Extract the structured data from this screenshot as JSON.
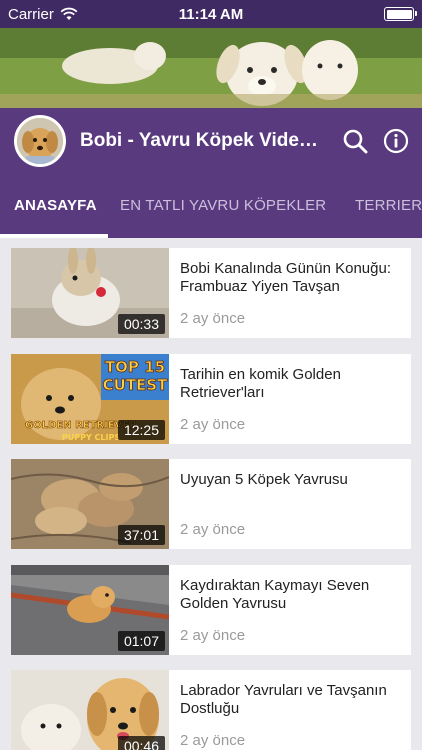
{
  "status_bar": {
    "carrier": "Carrier",
    "time": "11:14 AM",
    "battery_level": 1.0
  },
  "channel": {
    "title": "Bobi - Yavru Köpek Videoları"
  },
  "header_icons": {
    "search": "search-icon",
    "info": "info-icon"
  },
  "tabs": [
    {
      "label": "ANASAYFA",
      "active": true
    },
    {
      "label": "EN TATLI YAVRU KÖPEKLER",
      "active": false
    },
    {
      "label": "TERRIER",
      "active": false
    }
  ],
  "videos": [
    {
      "title": "Bobi Kanalında Günün Konuğu: Frambuaz Yiyen Tavşan",
      "age": "2 ay önce",
      "duration": "00:33"
    },
    {
      "title": "Tarihin en komik Golden Retriever'ları",
      "age": "2 ay önce",
      "duration": "12:25"
    },
    {
      "title": "Uyuyan 5 Köpek Yavrusu",
      "age": "2 ay önce",
      "duration": "37:01"
    },
    {
      "title": "Kaydıraktan Kaymayı Seven Golden Yavrusu",
      "age": "2 ay önce",
      "duration": "01:07"
    },
    {
      "title": "Labrador Yavruları ve Tavşanın Dostluğu",
      "age": "2 ay önce",
      "duration": "00:46"
    }
  ],
  "thumb_texts": {
    "top15_line1": "TOP 15",
    "top15_line2": "CUTEST",
    "top15_line3": "GOLDEN RETRIEVER",
    "top15_line4": "PUPPY CLIPS"
  },
  "colors": {
    "primary": "#5a3a7e",
    "status_bar": "#3f2a63",
    "background": "#e9e9ed"
  }
}
